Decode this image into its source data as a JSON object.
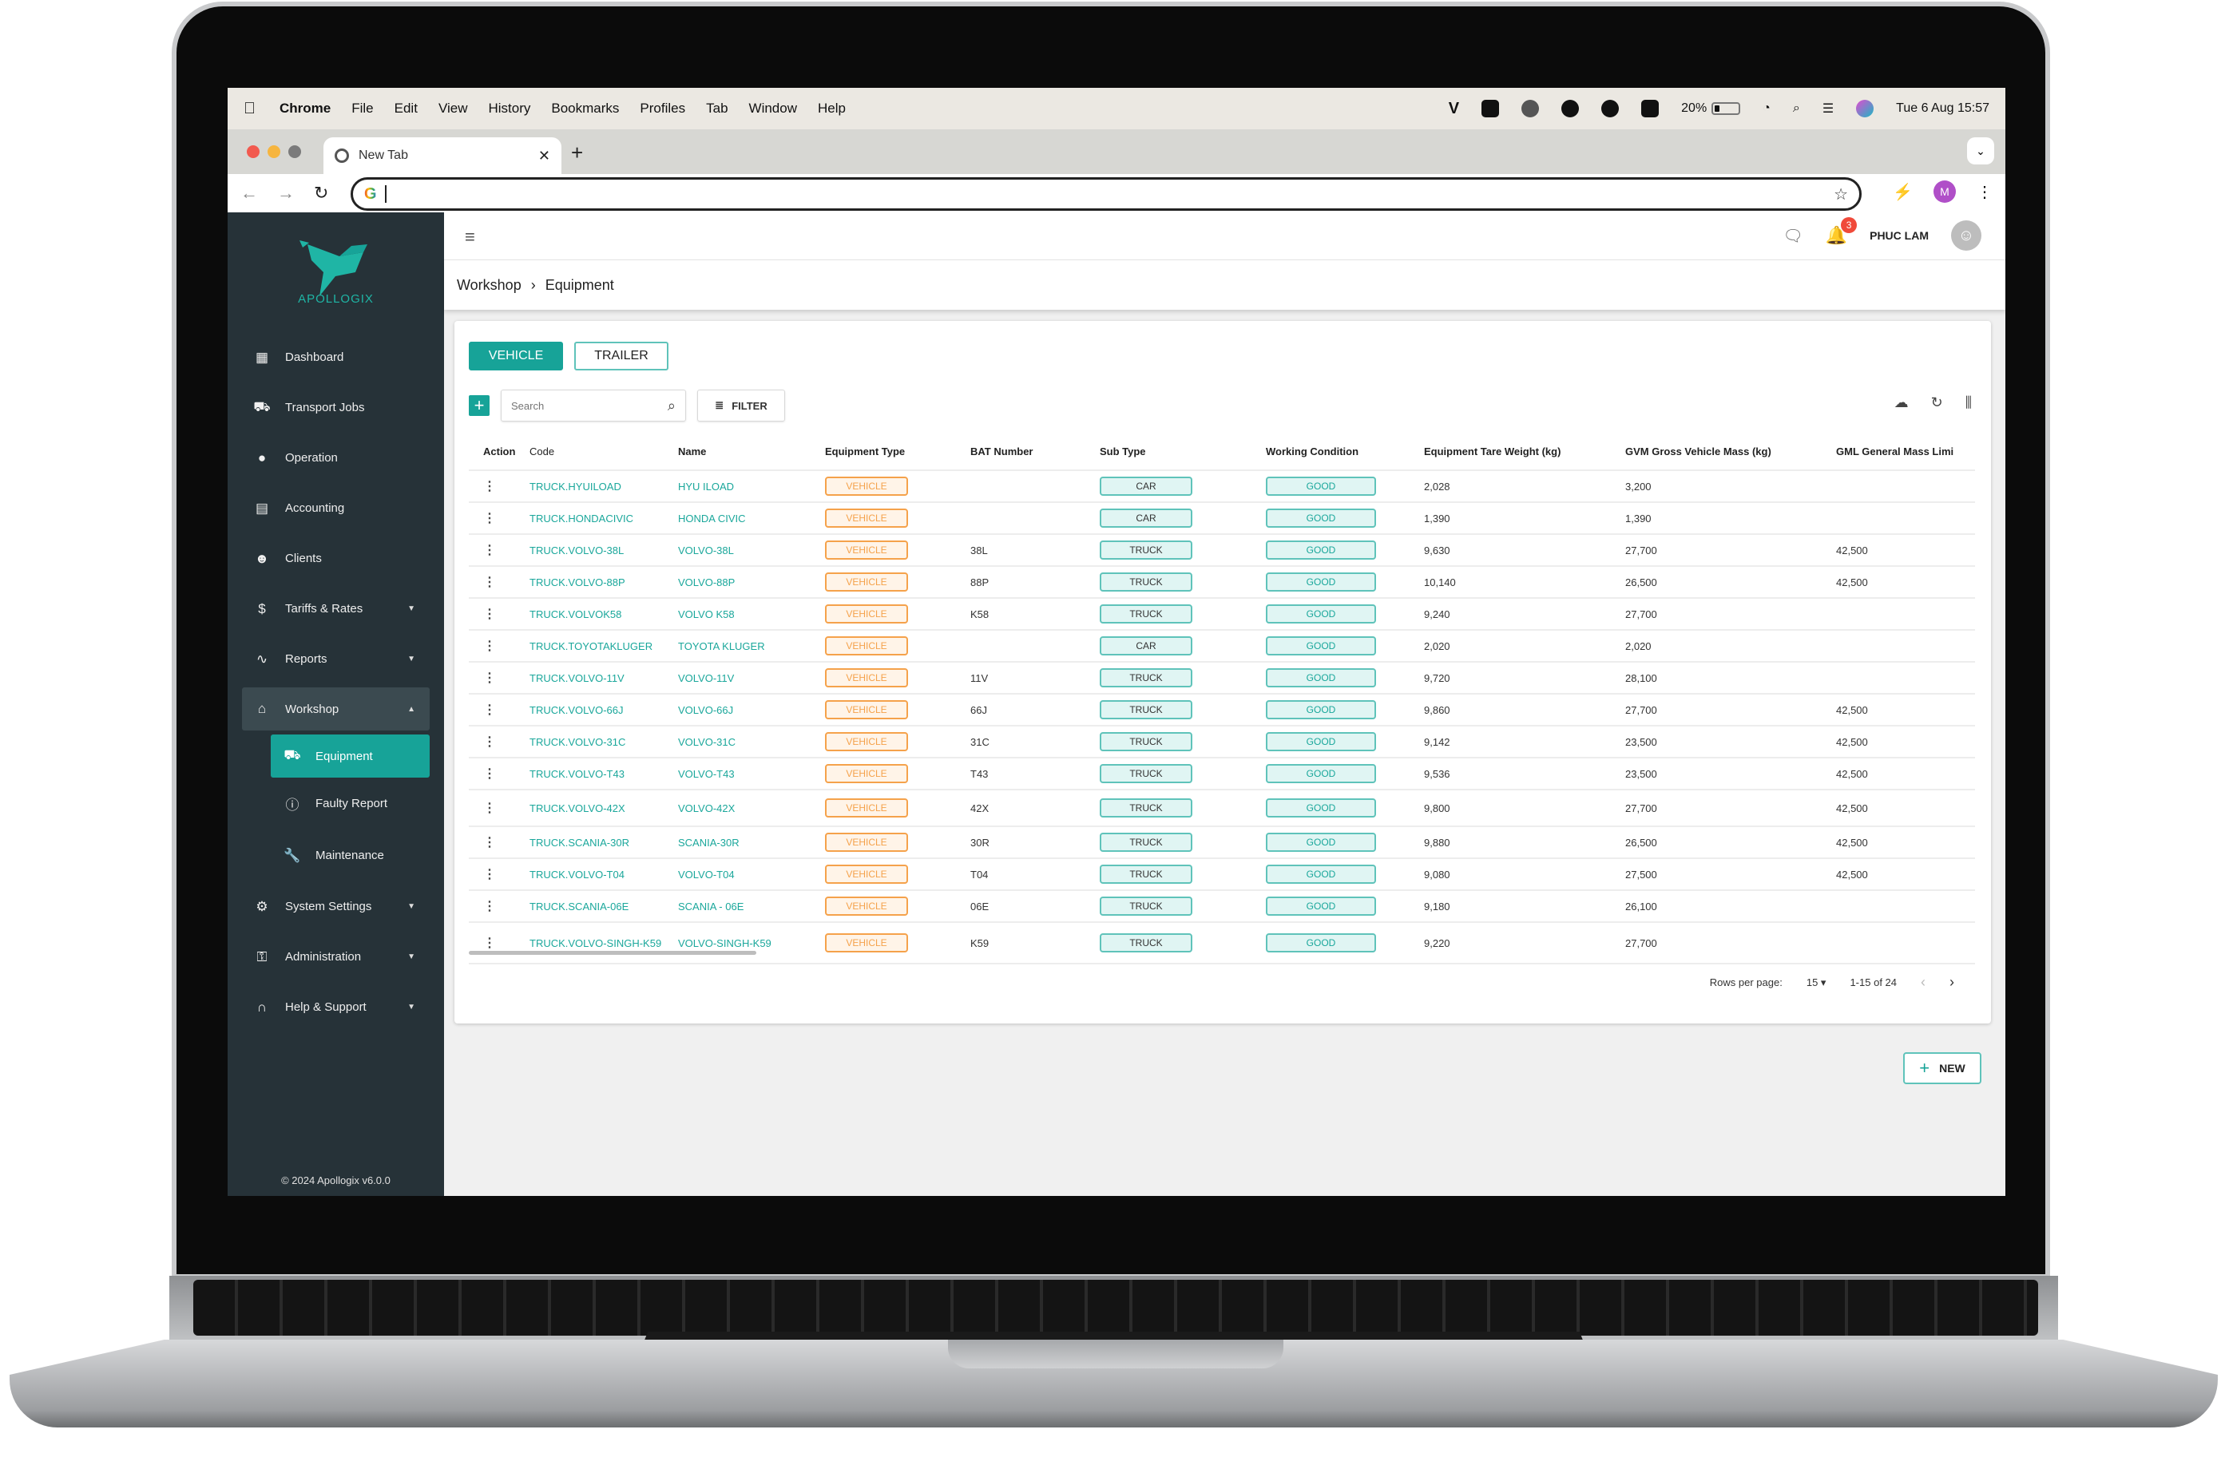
{
  "os_menubar": {
    "app_name": "Chrome",
    "menus": [
      "File",
      "Edit",
      "View",
      "History",
      "Bookmarks",
      "Profiles",
      "Tab",
      "Window",
      "Help"
    ],
    "tray_icons": [
      "vpn-icon",
      "teamviewer-icon",
      "cloud-sync-icon",
      "messenger-icon",
      "grammarly-icon",
      "checkmark-app-icon"
    ],
    "battery_percent": "20%",
    "battery_level": 0.2,
    "datetime": "Tue 6 Aug  15:57"
  },
  "browser": {
    "tab_title": "New Tab",
    "address_value": "",
    "profile_initial": "M"
  },
  "app": {
    "brand": "APOLLOGIX",
    "user_name": "PHUC LAM",
    "notification_count": "3",
    "copyright": "© 2024 Apollogix v6.0.0",
    "breadcrumb": [
      "Workshop",
      "Equipment"
    ],
    "sidebar": {
      "items": [
        {
          "label": "Dashboard",
          "icon": "dashboard-icon"
        },
        {
          "label": "Transport Jobs",
          "icon": "truck-icon"
        },
        {
          "label": "Operation",
          "icon": "location-pin-icon"
        },
        {
          "label": "Accounting",
          "icon": "ledger-icon"
        },
        {
          "label": "Clients",
          "icon": "people-icon"
        },
        {
          "label": "Tariffs & Rates",
          "icon": "dollar-icon",
          "expandable": true
        },
        {
          "label": "Reports",
          "icon": "trend-line-icon",
          "expandable": true
        },
        {
          "label": "Workshop",
          "icon": "garage-icon",
          "expandable": true,
          "expanded": true
        },
        {
          "label": "System Settings",
          "icon": "gear-icon",
          "expandable": true
        },
        {
          "label": "Administration",
          "icon": "key-icon",
          "expandable": true
        },
        {
          "label": "Help & Support",
          "icon": "headset-icon",
          "expandable": true
        }
      ],
      "workshop_sub": [
        {
          "label": "Equipment",
          "icon": "equipment-icon",
          "active": true
        },
        {
          "label": "Faulty Report",
          "icon": "alert-icon"
        },
        {
          "label": "Maintenance",
          "icon": "wrench-icon"
        }
      ]
    },
    "toggle": {
      "vehicle": "VEHICLE",
      "trailer": "TRAILER",
      "active": "VEHICLE"
    },
    "search_placeholder": "Search",
    "filter_label": "FILTER",
    "table": {
      "columns": [
        "Action",
        "Code",
        "Name",
        "Equipment Type",
        "BAT Number",
        "Sub Type",
        "Working Condition",
        "Equipment Tare Weight (kg)",
        "GVM Gross Vehicle Mass (kg)",
        "GML General Mass Limi"
      ],
      "rows": [
        {
          "code": "TRUCK.HYUILOAD",
          "name": "HYU ILOAD",
          "type": "VEHICLE",
          "bat": "",
          "sub": "CAR",
          "cond": "GOOD",
          "tare": "2,028",
          "gvm": "3,200",
          "gml": ""
        },
        {
          "code": "TRUCK.HONDACIVIC",
          "name": "HONDA CIVIC",
          "type": "VEHICLE",
          "bat": "",
          "sub": "CAR",
          "cond": "GOOD",
          "tare": "1,390",
          "gvm": "1,390",
          "gml": ""
        },
        {
          "code": "TRUCK.VOLVO-38L",
          "name": "VOLVO-38L",
          "type": "VEHICLE",
          "bat": "38L",
          "sub": "TRUCK",
          "cond": "GOOD",
          "tare": "9,630",
          "gvm": "27,700",
          "gml": "42,500"
        },
        {
          "code": "TRUCK.VOLVO-88P",
          "name": "VOLVO-88P",
          "type": "VEHICLE",
          "bat": "88P",
          "sub": "TRUCK",
          "cond": "GOOD",
          "tare": "10,140",
          "gvm": "26,500",
          "gml": "42,500"
        },
        {
          "code": "TRUCK.VOLVOK58",
          "name": "VOLVO K58",
          "type": "VEHICLE",
          "bat": "K58",
          "sub": "TRUCK",
          "cond": "GOOD",
          "tare": "9,240",
          "gvm": "27,700",
          "gml": ""
        },
        {
          "code": "TRUCK.TOYOTAKLUGER",
          "name": "TOYOTA KLUGER",
          "type": "VEHICLE",
          "bat": "",
          "sub": "CAR",
          "cond": "GOOD",
          "tare": "2,020",
          "gvm": "2,020",
          "gml": ""
        },
        {
          "code": "TRUCK.VOLVO-11V",
          "name": "VOLVO-11V",
          "type": "VEHICLE",
          "bat": "11V",
          "sub": "TRUCK",
          "cond": "GOOD",
          "tare": "9,720",
          "gvm": "28,100",
          "gml": ""
        },
        {
          "code": "TRUCK.VOLVO-66J",
          "name": "VOLVO-66J",
          "type": "VEHICLE",
          "bat": "66J",
          "sub": "TRUCK",
          "cond": "GOOD",
          "tare": "9,860",
          "gvm": "27,700",
          "gml": "42,500"
        },
        {
          "code": "TRUCK.VOLVO-31C",
          "name": "VOLVO-31C",
          "type": "VEHICLE",
          "bat": "31C",
          "sub": "TRUCK",
          "cond": "GOOD",
          "tare": "9,142",
          "gvm": "23,500",
          "gml": "42,500"
        },
        {
          "code": "TRUCK.VOLVO-T43",
          "name": "VOLVO-T43",
          "type": "VEHICLE",
          "bat": "T43",
          "sub": "TRUCK",
          "cond": "GOOD",
          "tare": "9,536",
          "gvm": "23,500",
          "gml": "42,500"
        },
        {
          "code": "TRUCK.VOLVO-42X",
          "name": "VOLVO-42X",
          "type": "VEHICLE",
          "bat": "42X",
          "sub": "TRUCK",
          "cond": "GOOD",
          "tare": "9,800",
          "gvm": "27,700",
          "gml": "42,500"
        },
        {
          "code": "TRUCK.SCANIA-30R",
          "name": "SCANIA-30R",
          "type": "VEHICLE",
          "bat": "30R",
          "sub": "TRUCK",
          "cond": "GOOD",
          "tare": "9,880",
          "gvm": "26,500",
          "gml": "42,500"
        },
        {
          "code": "TRUCK.VOLVO-T04",
          "name": "VOLVO-T04",
          "type": "VEHICLE",
          "bat": "T04",
          "sub": "TRUCK",
          "cond": "GOOD",
          "tare": "9,080",
          "gvm": "27,500",
          "gml": "42,500"
        },
        {
          "code": "TRUCK.SCANIA-06E",
          "name": "SCANIA - 06E",
          "type": "VEHICLE",
          "bat": "06E",
          "sub": "TRUCK",
          "cond": "GOOD",
          "tare": "9,180",
          "gvm": "26,100",
          "gml": ""
        },
        {
          "code": "TRUCK.VOLVO-SINGH-K59",
          "name": "VOLVO-SINGH-K59",
          "type": "VEHICLE",
          "bat": "K59",
          "sub": "TRUCK",
          "cond": "GOOD",
          "tare": "9,220",
          "gvm": "27,700",
          "gml": ""
        }
      ]
    },
    "pagination": {
      "rows_per_page_label": "Rows per page:",
      "rows_per_page": "15",
      "range": "1-15 of 24"
    },
    "new_button": "NEW",
    "colors": {
      "primary": "#17a398",
      "sidebar_bg": "#263238",
      "vehicle_badge": "#f5a24b",
      "notification": "#f04a3a"
    }
  }
}
